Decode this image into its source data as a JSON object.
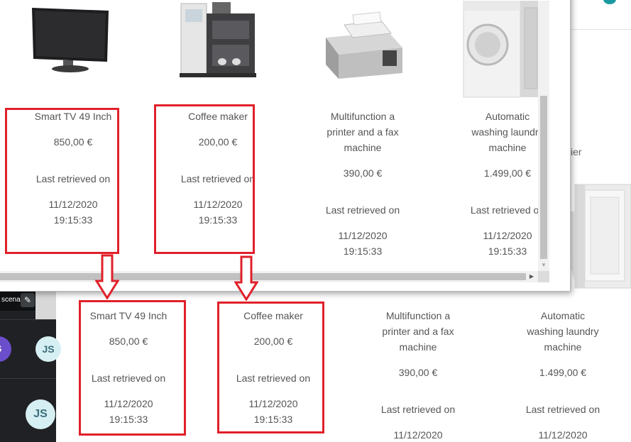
{
  "popup": {
    "products": [
      {
        "name": "Smart TV 49 Inch",
        "price": "850,00 €",
        "retrieved_label": "Last retrieved on",
        "date": "11/12/2020",
        "time": "19:15:33",
        "image_icon": "tv-image"
      },
      {
        "name": "Coffee maker",
        "price": "200,00 €",
        "retrieved_label": "Last retrieved on",
        "date": "11/12/2020",
        "time": "19:15:33",
        "image_icon": "coffee-maker-image"
      },
      {
        "name_lines": [
          "Multifunction a",
          "printer and a fax",
          "machine"
        ],
        "price": "390,00 €",
        "retrieved_label": "Last retrieved on",
        "date": "11/12/2020",
        "time": "19:15:33",
        "image_icon": "printer-image"
      },
      {
        "name_lines": [
          "Automatic",
          "washing laundry",
          "machine"
        ],
        "price": "1.499,00 €",
        "retrieved_label": "Last retrieved on",
        "date": "11/12/2020",
        "time": "19:15:33",
        "image_icon": "washing-machine-image"
      }
    ]
  },
  "page": {
    "products": [
      {
        "name": "Smart TV 49 Inch",
        "price": "850,00 €",
        "retrieved_label": "Last retrieved on",
        "date": "11/12/2020",
        "time": "19:15:33"
      },
      {
        "name": "Coffee maker",
        "price": "200,00 €",
        "retrieved_label": "Last retrieved on",
        "date": "11/12/2020",
        "time": "19:15:33"
      },
      {
        "name_lines": [
          "Multifunction a",
          "printer and a fax",
          "machine"
        ],
        "price": "390,00 €",
        "retrieved_label": "Last retrieved on",
        "date": "11/12/2020"
      },
      {
        "name_lines": [
          "Automatic",
          "washing laundry",
          "machine"
        ],
        "price": "1.499,00 €",
        "retrieved_label": "Last retrieved on",
        "date": "11/12/2020"
      }
    ],
    "fragment_text": "ier"
  },
  "call_panel": {
    "scene_label": "scena",
    "avatars": [
      {
        "initials": "S",
        "color": "#6b4ecb"
      },
      {
        "initials": "JS",
        "color": "#d6eff3"
      },
      {
        "initials": "JS",
        "color": "#d6eff3"
      }
    ]
  },
  "annotation_color": "#e0202a",
  "accent_teal": "#1a9aa0"
}
